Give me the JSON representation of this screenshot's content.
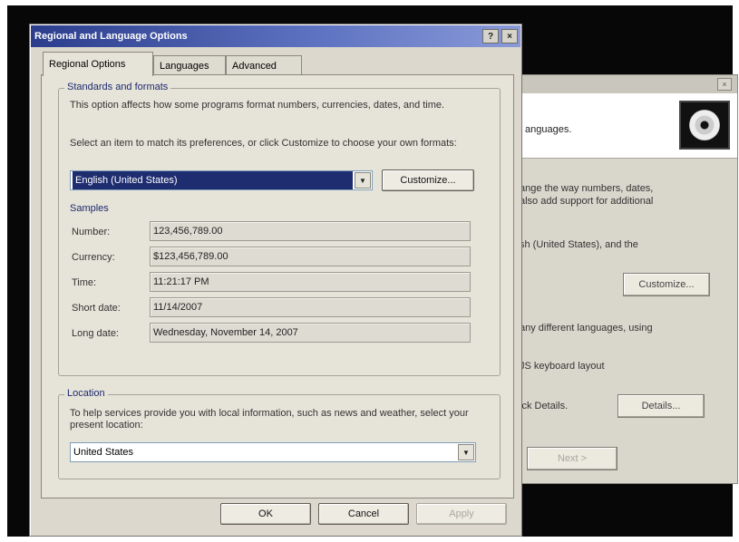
{
  "dialog": {
    "title": "Regional and Language Options",
    "help_glyph": "?",
    "close_glyph": "×",
    "tabs": [
      {
        "label": "Regional Options"
      },
      {
        "label": "Languages"
      },
      {
        "label": "Advanced"
      }
    ],
    "standards": {
      "legend": "Standards and formats",
      "description": "This option affects how some programs format numbers, currencies, dates, and time.",
      "instruction": "Select an item to match its preferences, or click Customize to choose your own formats:",
      "selected_locale": "English (United States)",
      "customize_label": "Customize...",
      "samples_heading": "Samples",
      "samples": [
        {
          "label": "Number:",
          "value": "123,456,789.00"
        },
        {
          "label": "Currency:",
          "value": "$123,456,789.00"
        },
        {
          "label": "Time:",
          "value": "11:21:17 PM"
        },
        {
          "label": "Short date:",
          "value": "11/14/2007"
        },
        {
          "label": "Long date:",
          "value": "Wednesday, November 14, 2007"
        }
      ]
    },
    "location": {
      "legend": "Location",
      "description": "To help services provide you with local information, such as news and weather, select your present location:",
      "selected": "United States"
    },
    "footer": {
      "ok_label": "OK",
      "cancel_label": "Cancel",
      "apply_label": "Apply"
    }
  },
  "back_window": {
    "close_glyph": "×",
    "banner_text": "anguages.",
    "text_1": "ange the way numbers, dates,",
    "text_2": "also add support for additional",
    "text_3": "sh (United States), and the",
    "customize_label": "Customize...",
    "text_4": "any different languages, using",
    "text_5": "JS keyboard layout",
    "text_6": "ick Details.",
    "details_label": "Details...",
    "next_label": "Next >"
  },
  "colors": {
    "titlebar": "#2b3d8c",
    "selection": "#1e2c70",
    "dialog_face": "#dcd8cd"
  }
}
